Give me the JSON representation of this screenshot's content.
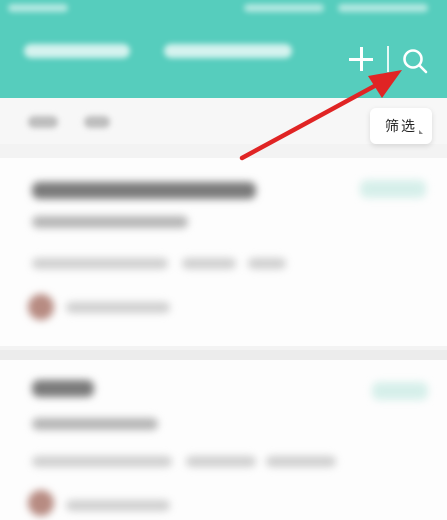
{
  "header": {
    "tab_count": 2,
    "accent": "#56cdbd",
    "icons": [
      "plus-icon",
      "search-icon"
    ]
  },
  "filter": {
    "label": "筛选"
  },
  "annotation": {
    "color": "#e02424"
  }
}
